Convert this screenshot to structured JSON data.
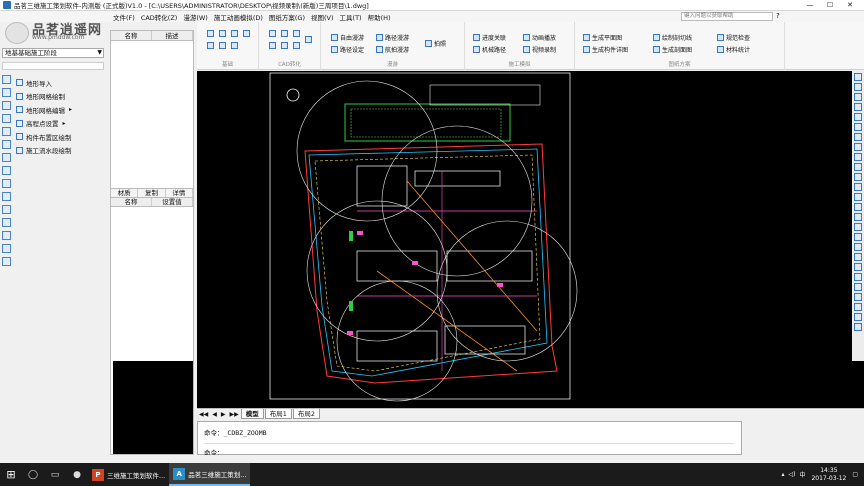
{
  "window": {
    "title": "品茗三维施工策划软件-内测版 (正式版)V1.0 - [C:\\USERS\\ADMINISTRATOR\\DESKTOP\\视频录制\\(新版)三周项目\\1.dwg]",
    "minimize": "—",
    "maximize": "☐",
    "close": "✕"
  },
  "menu": {
    "items": [
      "文件(F)",
      "CAD转化(Z)",
      "漫游(W)",
      "施工动画模拟(D)",
      "图纸方案(G)",
      "视图(V)",
      "工具(T)",
      "帮助(H)"
    ],
    "search_placeholder": "键入问题以获取帮助",
    "help_icon": "?"
  },
  "logo": {
    "brand": "品茗逍遥网",
    "url": "www.pmddw.com"
  },
  "left_panel": {
    "stage_selector": "地基基础施工阶段",
    "tree": [
      {
        "label": "地形导入",
        "arrow": ""
      },
      {
        "label": "地形网格绘制",
        "arrow": ""
      },
      {
        "label": "地形网格编辑",
        "arrow": "▸"
      },
      {
        "label": "高程点设置",
        "arrow": "▸"
      },
      {
        "label": "构件布置区绘制",
        "arrow": ""
      },
      {
        "label": "施工流水段绘制",
        "arrow": ""
      }
    ]
  },
  "props_panel": {
    "headers": [
      "名称",
      "描述"
    ],
    "tabs": [
      "材质",
      "复制",
      "详情"
    ],
    "prop_headers": [
      "名称",
      "设置值"
    ]
  },
  "ribbon": {
    "groups": [
      {
        "label": "基础"
      },
      {
        "label": "CAD转化"
      },
      {
        "label": "漫游"
      },
      {
        "label": "施工模拟"
      },
      {
        "label": "图纸方案"
      }
    ],
    "buttons": {
      "free_roam": "自由漫游",
      "path_setting": "路径设定",
      "path_roam": "路径漫游",
      "view_roam": "航拍漫游",
      "screenshot": "拍照",
      "progress_link": "进度关联",
      "machine_path": "机械路径",
      "anim_play": "动画播放",
      "video_record": "视频录制",
      "gen_plan": "生成平面图",
      "gen_detail": "生成构件详图",
      "draw_section": "绘制剖切线",
      "gen_section": "生成剖面图",
      "spec_check": "规范检查",
      "material_stats": "材料统计"
    }
  },
  "sheet_tabs": {
    "tabs": [
      "模型",
      "布局1",
      "布局2"
    ],
    "active": "模型"
  },
  "command": {
    "line1": "命令：_CDBZ_ZOOMB",
    "line2": "命令："
  },
  "taskbar": {
    "task1": "三维施工策划软件...",
    "task2": "品茗三维施工策划...",
    "tray_lang": "中",
    "time": "14:35",
    "date": "2017-03-12"
  },
  "colors": {
    "canvas_bg": "#000000",
    "taskbar_bg": "#1b1b1b",
    "accent": "#3a77c2"
  }
}
